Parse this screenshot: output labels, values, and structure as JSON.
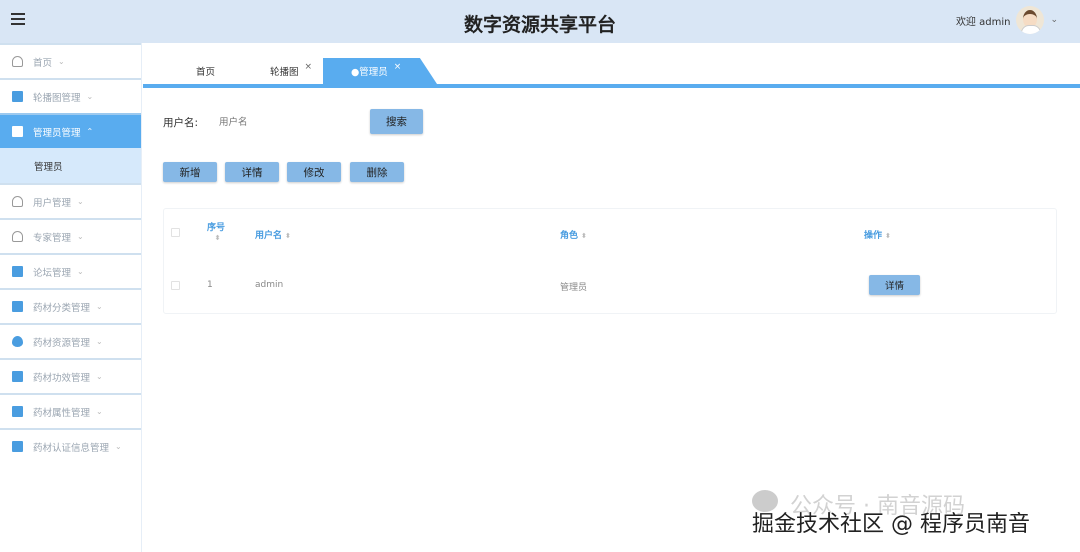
{
  "header": {
    "title": "数字资源共享平台",
    "welcome": "欢迎 admin"
  },
  "sidebar": {
    "items": [
      {
        "label": "首页",
        "icon": "home-icon"
      },
      {
        "label": "轮播图管理",
        "icon": "image-icon"
      },
      {
        "label": "管理员管理",
        "icon": "briefcase-icon",
        "active": true,
        "children": [
          {
            "label": "管理员"
          }
        ]
      },
      {
        "label": "用户管理",
        "icon": "user-icon"
      },
      {
        "label": "专家管理",
        "icon": "user-icon"
      },
      {
        "label": "论坛管理",
        "icon": "folder-icon"
      },
      {
        "label": "药材分类管理",
        "icon": "book-icon"
      },
      {
        "label": "药材资源管理",
        "icon": "drop-icon"
      },
      {
        "label": "药材功效管理",
        "icon": "box-icon"
      },
      {
        "label": "药材属性管理",
        "icon": "window-icon"
      },
      {
        "label": "药材认证信息管理",
        "icon": "card-icon"
      }
    ]
  },
  "tabs": [
    {
      "label": "首页"
    },
    {
      "label": "轮播图",
      "close": "×"
    },
    {
      "label": "●管理员",
      "close": "×"
    }
  ],
  "search": {
    "label": "用户名:",
    "placeholder": "用户名",
    "button": "搜索"
  },
  "actions": {
    "add": "新增",
    "detail": "详情",
    "edit": "修改",
    "delete": "删除"
  },
  "table": {
    "headers": [
      "序号",
      "用户名",
      "角色",
      "操作"
    ],
    "rows": [
      {
        "index": "1",
        "username": "admin",
        "role": "管理员",
        "action": "详情"
      }
    ]
  },
  "watermark": {
    "line1": "公众号 · 南音源码",
    "line2": "掘金技术社区 @ 程序员南音"
  },
  "colors": {
    "accent": "#59acef",
    "header_bg": "#d9e6f5",
    "button": "#86b8e6"
  }
}
